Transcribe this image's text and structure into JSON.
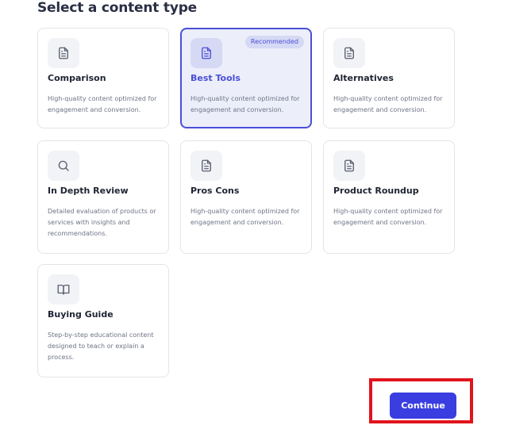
{
  "page": {
    "heading": "Select a content type"
  },
  "cards": [
    {
      "title": "Comparison",
      "description": "High-quality content optimized for engagement and conversion.",
      "icon": "document-icon",
      "selected": false
    },
    {
      "title": "Best Tools",
      "description": "High-quality content optimized for engagement and conversion.",
      "icon": "document-icon",
      "selected": true,
      "badge": "Recommended"
    },
    {
      "title": "Alternatives",
      "description": "High-quality content optimized for engagement and conversion.",
      "icon": "document-icon",
      "selected": false
    },
    {
      "title": "In Depth Review",
      "description": "Detailed evaluation of products or services with insights and recommendations.",
      "icon": "search-icon",
      "selected": false
    },
    {
      "title": "Pros Cons",
      "description": "High-quality content optimized for engagement and conversion.",
      "icon": "document-icon",
      "selected": false
    },
    {
      "title": "Product Roundup",
      "description": "High-quality content optimized for engagement and conversion.",
      "icon": "document-icon",
      "selected": false
    },
    {
      "title": "Buying Guide",
      "description": "Step-by-step educational content designed to teach or explain a process.",
      "icon": "book-icon",
      "selected": false
    }
  ],
  "footer": {
    "continue_label": "Continue"
  },
  "colors": {
    "accent": "#3a3ee0",
    "selected_border": "#4a4fd6",
    "selected_background": "#eceefa",
    "highlight_annotation": "#e0141c"
  }
}
